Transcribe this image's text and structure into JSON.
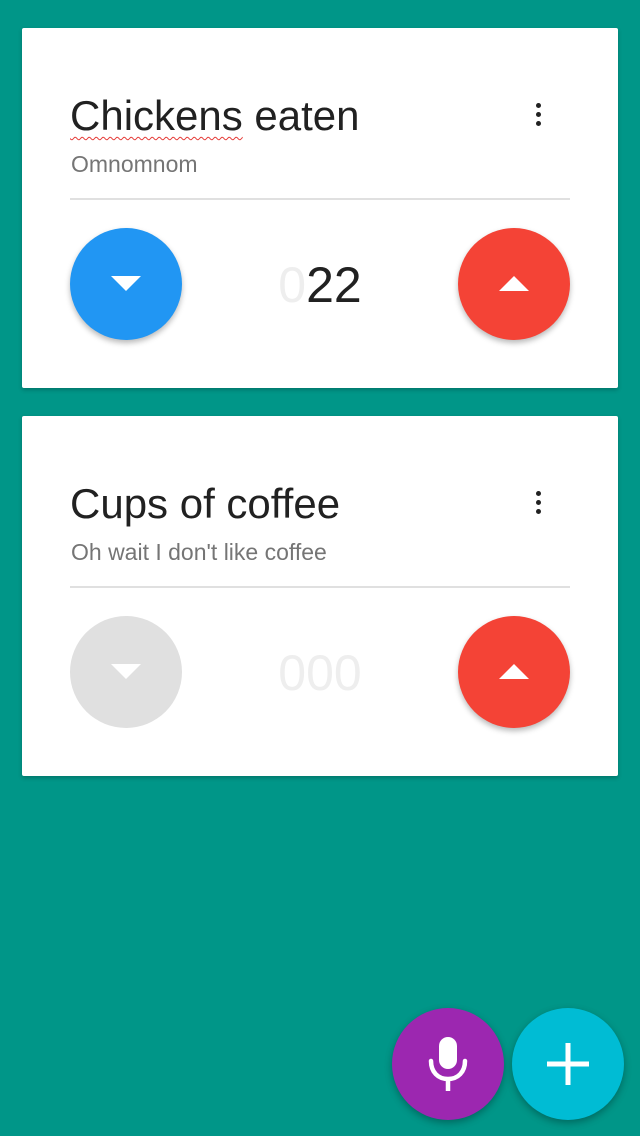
{
  "colors": {
    "background": "#009688",
    "card": "#ffffff",
    "decrement_active": "#2196f3",
    "decrement_disabled": "#e0e0e0",
    "increment": "#f44336",
    "mic_fab": "#9c27b0",
    "add_fab": "#00bcd4",
    "counter_leading_zero": "#eeeeee",
    "counter_digits": "#212121"
  },
  "counters": [
    {
      "title_misspelled": "Chickens",
      "title_rest": " eaten",
      "subtitle": "Omnomnom",
      "menu_icon": "more-vert-icon",
      "decrement_icon": "arrow-down-icon",
      "increment_icon": "arrow-up-icon",
      "value_leading_zeros": "0",
      "value_digits": "22"
    },
    {
      "title": "Cups of coffee",
      "subtitle": "Oh wait I don't like coffee",
      "menu_icon": "more-vert-icon",
      "decrement_icon": "arrow-down-icon",
      "increment_icon": "arrow-up-icon",
      "value_leading_zeros": "000",
      "value_digits": ""
    }
  ],
  "fabs": {
    "mic_icon": "microphone-icon",
    "add_icon": "plus-icon"
  }
}
